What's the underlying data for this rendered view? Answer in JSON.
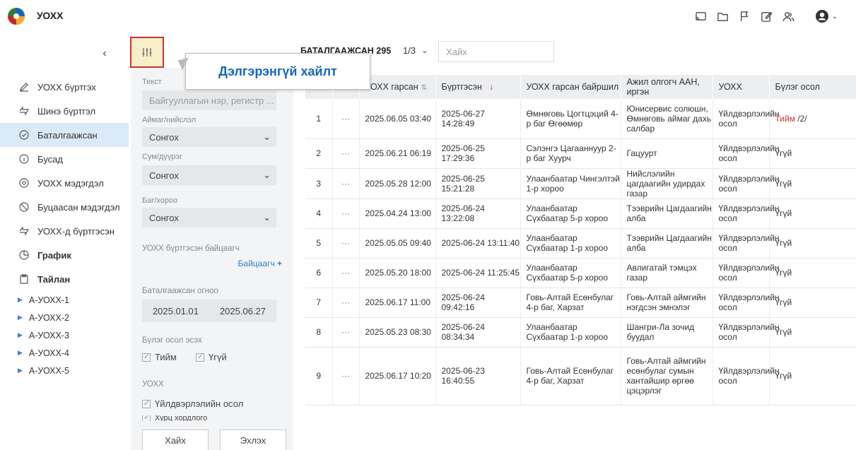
{
  "header": {
    "title": "УОХХ",
    "icons": [
      "cast-icon",
      "folder-icon",
      "flag-icon",
      "edit-icon",
      "users-icon",
      "user-icon"
    ]
  },
  "sidebar": {
    "items": [
      {
        "label": "УОХХ бүртгэх",
        "icon": "pen-icon"
      },
      {
        "label": "Шинэ бүртгэл",
        "icon": "bolt-icon"
      },
      {
        "label": "Баталгаажсан",
        "icon": "check-circle-icon"
      },
      {
        "label": "Бусад",
        "icon": "info-icon"
      },
      {
        "label": "УОХХ мэдэгдэл",
        "icon": "location-icon"
      },
      {
        "label": "Буцаасан мэдэгдэл",
        "icon": "ban-icon"
      },
      {
        "label": "УОХХ-д бүртгэсэн",
        "icon": "bolt-icon"
      },
      {
        "label": "График",
        "icon": "pie-chart-icon"
      },
      {
        "label": "Тайлан",
        "icon": "clipboard-icon"
      }
    ],
    "sub_items": [
      "А-УОХХ-1",
      "А-УОХХ-2",
      "А-УОХХ-3",
      "А-УОХХ-4",
      "А-УОХХ-5"
    ]
  },
  "filter": {
    "text_label": "Текст",
    "text_placeholder": "Байгууллагын нэр, регистр ...",
    "aimag_label": "Аймаг/нийслэл",
    "aimag_value": "Сонгох",
    "sum_label": "Сум/дүүрэг",
    "sum_value": "Сонгох",
    "bag_label": "Баг/хороо",
    "bag_value": "Сонгох",
    "inspector_label": "УОХХ бүртгэсэн байцаагч",
    "inspector_add": "Байцаагч",
    "date_label": "Баталгаажсан огноо",
    "date_from": "2025.01.01",
    "date_to": "2025.06.27",
    "group_label": "Бүлэг осол эсэх",
    "group_yes": "Тийм",
    "group_no": "Үгүй",
    "type_label": "УОХХ",
    "type_opt1": "Үйлдвэрлэлийн осол",
    "type_opt2": "Хурц хордлого",
    "search_btn": "Хайх",
    "reset_btn": "Эхлэх"
  },
  "tooltip": "Дэлгэрэнгүй хайлт",
  "toolbar": {
    "count_label": "БАТАЛГААЖСАН 295",
    "page": "1/3",
    "search_placeholder": "Хайх"
  },
  "table": {
    "columns": [
      "",
      "",
      "УОХХ гарсан",
      "Бүртгэсэн",
      "УОХХ гарсан байршил",
      "Ажил олгогч ААН, иргэн",
      "УОХХ",
      "Бүлэг осол"
    ],
    "rows": [
      {
        "n": "1",
        "occurred": "2025.06.05 03:40",
        "registered": "2025-06-27 14:28:49",
        "location": "Өмнөговь Цогтцэций 4-р баг Өгөөмөр",
        "employer": "Юнисервис солюшн, Өмнөговь аймаг дахь салбар",
        "type": "Үйлдвэрлэлийн осол",
        "group": "Тийм",
        "group_extra": " /2/"
      },
      {
        "n": "2",
        "occurred": "2025.06.21 06:19",
        "registered": "2025-06-25 17:29:36",
        "location": "Сэлэнгэ Цагааннуур 2-р баг Хуурч",
        "employer": "Гацуурт",
        "type": "Үйлдвэрлэлийн осол",
        "group": "Үгүй",
        "group_extra": ""
      },
      {
        "n": "3",
        "occurred": "2025.05.28 12:00",
        "registered": "2025-06-25 15:21:28",
        "location": "Улаанбаатар Чингэлтэй 1-р хороо",
        "employer": "Нийслэлийн цагдаагийн удирдах газар",
        "type": "Үйлдвэрлэлийн осол",
        "group": "Үгүй",
        "group_extra": ""
      },
      {
        "n": "4",
        "occurred": "2025.04.24 13:00",
        "registered": "2025-06-24 13:22:08",
        "location": "Улаанбаатар Сүхбаатар 5-р хороо",
        "employer": "Тээврийн Цагдаагийн алба",
        "type": "Үйлдвэрлэлийн осол",
        "group": "Үгүй",
        "group_extra": ""
      },
      {
        "n": "5",
        "occurred": "2025.05.05 09:40",
        "registered": "2025-06-24 13:11:40",
        "location": "Улаанбаатар Сүхбаатар 1-р хороо",
        "employer": "Тээврийн Цагдаагийн алба",
        "type": "Үйлдвэрлэлийн осол",
        "group": "Үгүй",
        "group_extra": ""
      },
      {
        "n": "6",
        "occurred": "2025.05.20 18:00",
        "registered": "2025-06-24 11:25:45",
        "location": "Улаанбаатар Сүхбаатар 5-р хороо",
        "employer": "Авлигатай тэмцэх газар",
        "type": "Үйлдвэрлэлийн осол",
        "group": "Үгүй",
        "group_extra": ""
      },
      {
        "n": "7",
        "occurred": "2025.06.17 11:00",
        "registered": "2025-06-24 09:42:16",
        "location": "Говь-Алтай Есөнбулаг 4-р баг, Харзат",
        "employer": "Говь-Алтай аймгийн нэгдсэн эмнэлэг",
        "type": "Үйлдвэрлэлийн осол",
        "group": "Үгүй",
        "group_extra": ""
      },
      {
        "n": "8",
        "occurred": "2025.05.23 08:30",
        "registered": "2025-06-24 08:34:34",
        "location": "Улаанбаатар Сүхбаатар 1-р хороо",
        "employer": "Шангри-Ла зочид буудал",
        "type": "Үйлдвэрлэлийн осол",
        "group": "Үгүй",
        "group_extra": ""
      },
      {
        "n": "9",
        "occurred": "2025.06.17 10:20",
        "registered": "2025-06-23 16:40:55",
        "location": "Говь-Алтай Есөнбулаг 4-р баг, Харзат",
        "employer": "Говь-Алтай аймгийн есөнбулаг сумын хантайшир өргөө цэцэрлэг",
        "type": "Үйлдвэрлэлийн осол",
        "group": "Үгүй",
        "group_extra": ""
      }
    ]
  },
  "colors": {
    "accent": "#2f7dd2",
    "active_bg": "#dbeaf8",
    "danger": "#d32f2f",
    "tooltip_text": "#1565c0"
  }
}
